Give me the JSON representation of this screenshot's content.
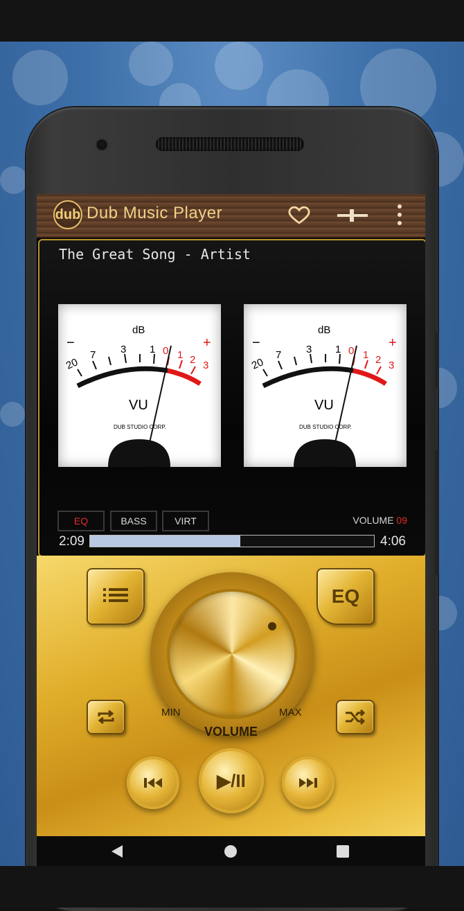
{
  "app": {
    "logo_text": "dub",
    "title": "Dub Music Player",
    "icons": [
      "heart-icon",
      "slider-icon",
      "more-vert-icon"
    ]
  },
  "player": {
    "song_title": "The Great Song - Artist",
    "time_elapsed": "2:09",
    "time_total": "4:06",
    "progress_fraction": 0.53
  },
  "vu_meters": [
    {
      "unit": "dB",
      "minus": "−",
      "plus": "+",
      "scale_labels": [
        "20",
        "7",
        "3",
        "1",
        "0",
        "1",
        "2",
        "3"
      ],
      "label": "VU",
      "brand": "DUB STUDIO CORP."
    },
    {
      "unit": "dB",
      "minus": "−",
      "plus": "+",
      "scale_labels": [
        "20",
        "7",
        "3",
        "1",
        "0",
        "1",
        "2",
        "3"
      ],
      "label": "VU",
      "brand": "DUB STUDIO CORP."
    }
  ],
  "effects": {
    "eq": "EQ",
    "bass": "BASS",
    "virt": "VIRT",
    "volume_label": "VOLUME",
    "volume_value": "09"
  },
  "controls": {
    "eq_button": "EQ",
    "min_label": "MIN",
    "max_label": "MAX",
    "volume_caption": "VOLUME",
    "play_pause": "▶/II"
  },
  "colors": {
    "accent_red": "#e52a2a",
    "gold": "#e0ad2a",
    "wood": "#5a3a26",
    "progress_fill": "#b9c8e2"
  }
}
